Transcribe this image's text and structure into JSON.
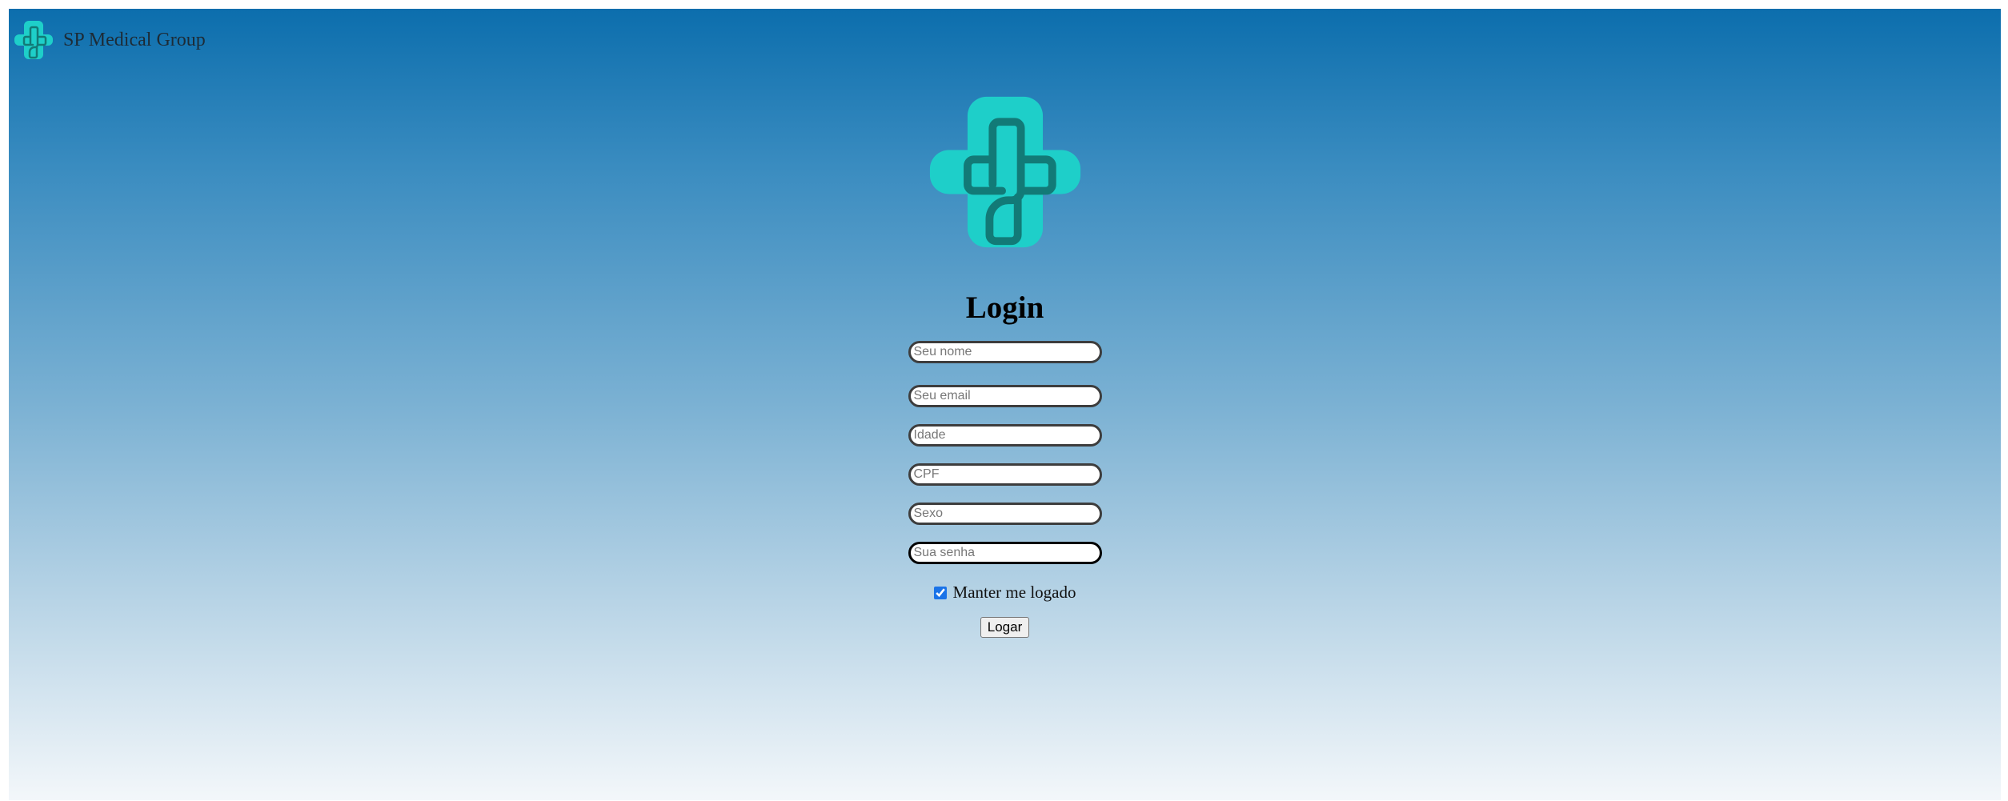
{
  "brand": {
    "name": "SP Medical Group",
    "logo_icon": "medical-cross-logo-icon",
    "colors": {
      "cross": "#1ecfc9",
      "stroke": "#127a77"
    }
  },
  "login": {
    "title": "Login",
    "fields": {
      "name_placeholder": "Seu nome",
      "email_placeholder": "Seu email",
      "age_placeholder": "Idade",
      "cpf_placeholder": "CPF",
      "sex_placeholder": "Sexo",
      "password_placeholder": "Sua senha"
    },
    "remember_label": "Manter me logado",
    "remember_checked": true,
    "submit_label": "Logar"
  },
  "background": {
    "top": "#0c6ead",
    "bottom": "#f3f7fa"
  }
}
